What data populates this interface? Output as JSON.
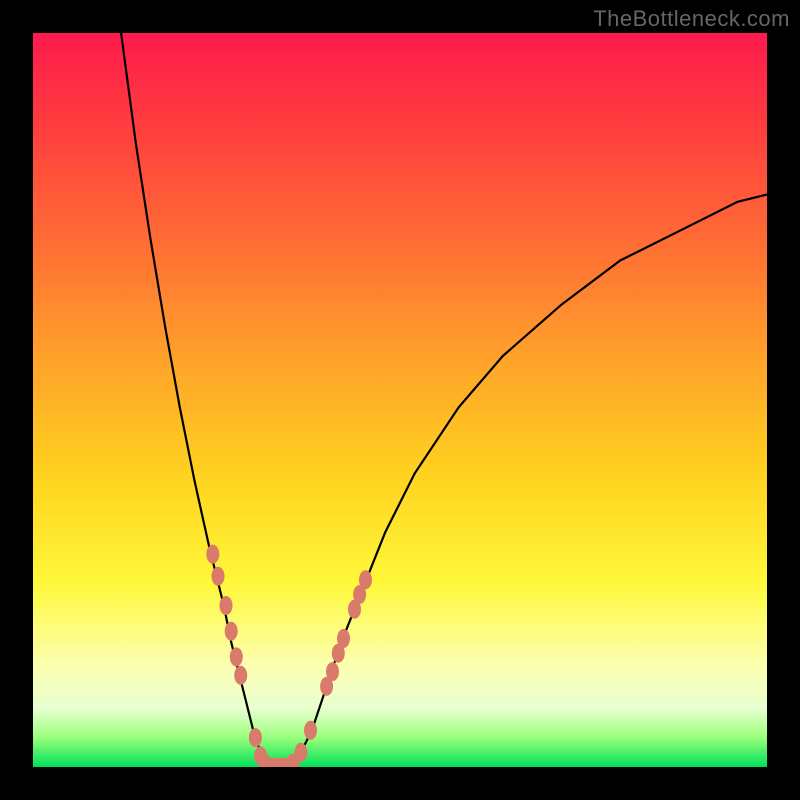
{
  "watermark": "TheBottleneck.com",
  "domain": "Chart",
  "colors": {
    "frame": "#000000",
    "marker": "#d97a6a",
    "curve": "#000000",
    "gradient_top": "#ff1a4d",
    "gradient_bottom": "#00e05a"
  },
  "chart_data": {
    "type": "line",
    "title": "",
    "xlabel": "",
    "ylabel": "",
    "xlim": [
      0,
      100
    ],
    "ylim": [
      0,
      100
    ],
    "grid": false,
    "legend": false,
    "curve": [
      {
        "x": 12,
        "y": 100
      },
      {
        "x": 14,
        "y": 85
      },
      {
        "x": 16,
        "y": 72
      },
      {
        "x": 18,
        "y": 60
      },
      {
        "x": 20,
        "y": 49
      },
      {
        "x": 22,
        "y": 39
      },
      {
        "x": 24,
        "y": 30
      },
      {
        "x": 26,
        "y": 22
      },
      {
        "x": 27,
        "y": 17
      },
      {
        "x": 28,
        "y": 13
      },
      {
        "x": 29,
        "y": 9
      },
      {
        "x": 30,
        "y": 5
      },
      {
        "x": 31,
        "y": 2
      },
      {
        "x": 32,
        "y": 0
      },
      {
        "x": 33,
        "y": 0
      },
      {
        "x": 34,
        "y": 0
      },
      {
        "x": 35,
        "y": 0
      },
      {
        "x": 36,
        "y": 1
      },
      {
        "x": 38,
        "y": 5
      },
      {
        "x": 40,
        "y": 11
      },
      {
        "x": 42,
        "y": 17
      },
      {
        "x": 44,
        "y": 22
      },
      {
        "x": 48,
        "y": 32
      },
      {
        "x": 52,
        "y": 40
      },
      {
        "x": 58,
        "y": 49
      },
      {
        "x": 64,
        "y": 56
      },
      {
        "x": 72,
        "y": 63
      },
      {
        "x": 80,
        "y": 69
      },
      {
        "x": 88,
        "y": 73
      },
      {
        "x": 96,
        "y": 77
      },
      {
        "x": 100,
        "y": 78
      }
    ],
    "markers_left": [
      {
        "x": 24.5,
        "y": 29
      },
      {
        "x": 25.2,
        "y": 26
      },
      {
        "x": 26.3,
        "y": 22
      },
      {
        "x": 27.0,
        "y": 18.5
      },
      {
        "x": 27.7,
        "y": 15
      },
      {
        "x": 28.3,
        "y": 12.5
      },
      {
        "x": 30.3,
        "y": 4
      },
      {
        "x": 31.0,
        "y": 1.5
      },
      {
        "x": 31.6,
        "y": 0.5
      }
    ],
    "markers_bottom": [
      {
        "x": 32.2,
        "y": 0
      },
      {
        "x": 33.0,
        "y": 0
      },
      {
        "x": 33.8,
        "y": 0
      },
      {
        "x": 34.6,
        "y": 0
      },
      {
        "x": 35.4,
        "y": 0.5
      }
    ],
    "markers_right": [
      {
        "x": 36.5,
        "y": 2
      },
      {
        "x": 37.8,
        "y": 5
      },
      {
        "x": 40.0,
        "y": 11
      },
      {
        "x": 40.8,
        "y": 13
      },
      {
        "x": 41.6,
        "y": 15.5
      },
      {
        "x": 42.3,
        "y": 17.5
      },
      {
        "x": 43.8,
        "y": 21.5
      },
      {
        "x": 44.5,
        "y": 23.5
      },
      {
        "x": 45.3,
        "y": 25.5
      }
    ]
  }
}
